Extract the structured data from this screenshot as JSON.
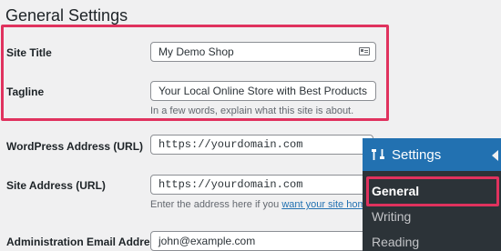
{
  "page": {
    "title": "General Settings"
  },
  "settings": {
    "site_title": {
      "label": "Site Title",
      "value": "My Demo Shop"
    },
    "tagline": {
      "label": "Tagline",
      "value": "Your Local Online Store with Best Products",
      "description": "In a few words, explain what this site is about."
    },
    "wp_address": {
      "label": "WordPress Address (URL)",
      "value": "https://yourdomain.com"
    },
    "site_address": {
      "label": "Site Address (URL)",
      "value": "https://yourdomain.com",
      "description_prefix": "Enter the address here if you ",
      "description_link": "want your site home pa"
    },
    "admin_email": {
      "label": "Administration Email Address",
      "value": "john@example.com"
    }
  },
  "admin_menu": {
    "title": "Settings",
    "items": [
      {
        "label": "General",
        "current": true
      },
      {
        "label": "Writing",
        "current": false
      },
      {
        "label": "Reading",
        "current": false
      }
    ]
  },
  "colors": {
    "highlight": "#e0325e",
    "menu_bg": "#2c3338",
    "menu_accent": "#2271b1",
    "link": "#2271b1"
  }
}
